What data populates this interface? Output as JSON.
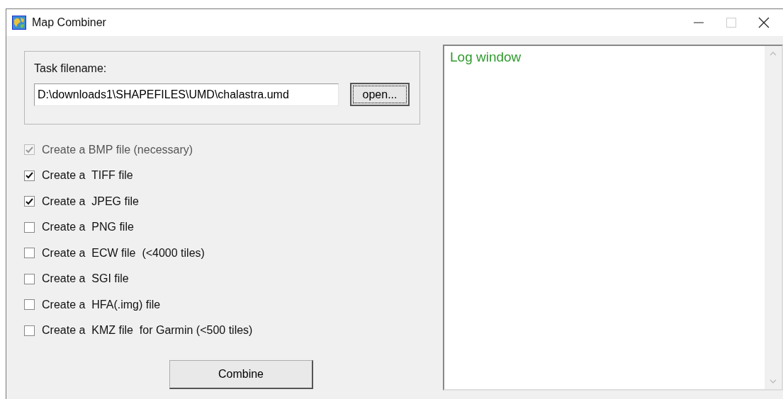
{
  "window": {
    "title": "Map Combiner"
  },
  "task": {
    "label": "Task filename:",
    "value": "D:\\downloads1\\SHAPEFILES\\UMD\\chalastra.umd",
    "button": "open..."
  },
  "options": [
    {
      "label": "Create a BMP file (necessary)",
      "checked": true,
      "disabled": true
    },
    {
      "label": "Create a  TIFF file",
      "checked": true,
      "disabled": false
    },
    {
      "label": "Create a  JPEG file",
      "checked": true,
      "disabled": false
    },
    {
      "label": "Create a  PNG file",
      "checked": false,
      "disabled": false
    },
    {
      "label": "Create a  ECW file  (<4000 tiles)",
      "checked": false,
      "disabled": false
    },
    {
      "label": "Create a  SGI file",
      "checked": false,
      "disabled": false
    },
    {
      "label": "Create a  HFA(.img) file",
      "checked": false,
      "disabled": false
    },
    {
      "label": "Create a  KMZ file  for Garmin (<500 tiles)",
      "checked": false,
      "disabled": false
    }
  ],
  "combine_button": "Combine",
  "log": {
    "text": "Log window"
  }
}
